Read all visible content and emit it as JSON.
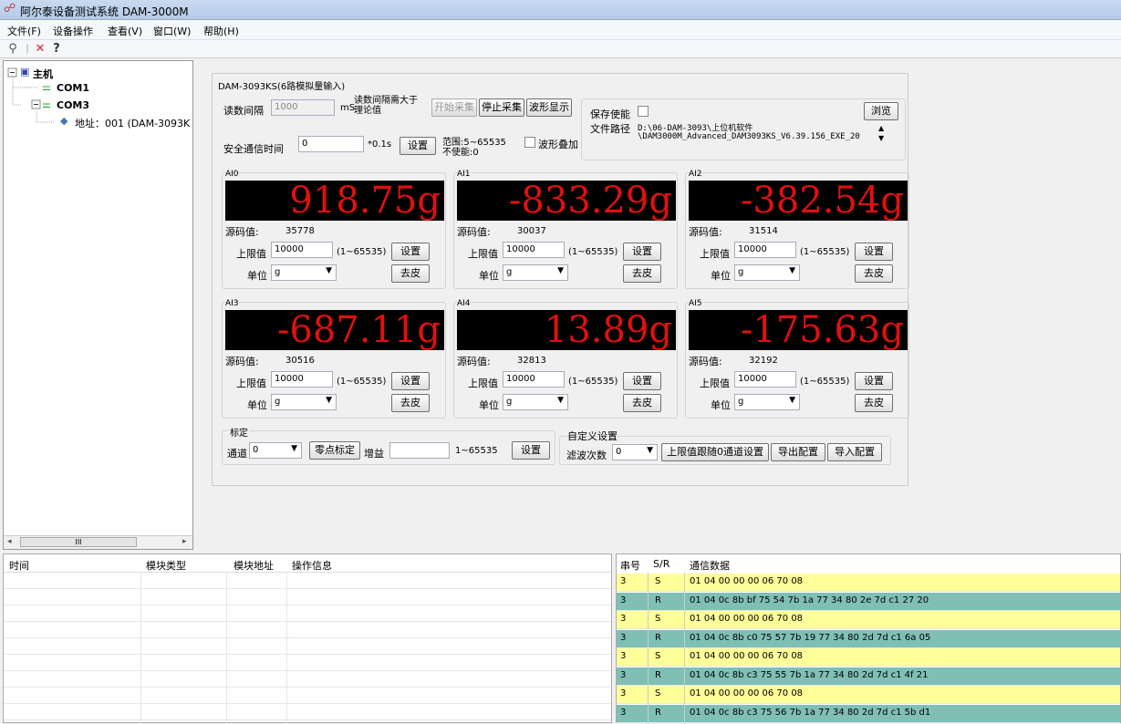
{
  "window": {
    "title": "阿尔泰设备测试系统 DAM-3000M"
  },
  "menu": [
    "文件(F)",
    "设备操作",
    "查看(V)",
    "窗口(W)",
    "帮助(H)"
  ],
  "tree": {
    "root": "主机",
    "com1": "COM1",
    "com3": "COM3",
    "addr": "地址：001 (DAM-3093K"
  },
  "device": {
    "title": "DAM-3093KS(6路模拟量输入)",
    "read_interval_label": "读数间隔",
    "read_interval_value": "1000",
    "read_interval_unit": "mS",
    "interval_note": "读数间隔需大于理论值",
    "btn_start": "开始采集",
    "btn_stop": "停止采集",
    "btn_wave": "波形显示",
    "save_enable": "保存使能",
    "browse": "浏览",
    "file_path_label": "文件路径",
    "file_path_line1": "D:\\06-DAM-3093\\上位机软件",
    "file_path_line2": "\\DAM3000M_Advanced_DAM3093KS_V6.39.156_EXE_20",
    "safe_time_label": "安全通信时间",
    "safe_time_value": "0",
    "safe_time_unit": "*0.1s",
    "safe_set": "设置",
    "range_note1": "范围:5~65535",
    "range_note2": "不使能:0",
    "wave_overlay": "波形叠加"
  },
  "channels": [
    {
      "name": "AI0",
      "value": "918.75g",
      "raw_label": "源码值:",
      "raw": "35778",
      "limit_label": "上限值",
      "limit": "10000",
      "range": "(1~65535)",
      "set": "设置",
      "unit_label": "单位",
      "unit": "g",
      "tare": "去皮"
    },
    {
      "name": "AI1",
      "value": "-833.29g",
      "raw_label": "源码值:",
      "raw": "30037",
      "limit_label": "上限值",
      "limit": "10000",
      "range": "(1~65535)",
      "set": "设置",
      "unit_label": "单位",
      "unit": "g",
      "tare": "去皮"
    },
    {
      "name": "AI2",
      "value": "-382.54g",
      "raw_label": "源码值:",
      "raw": "31514",
      "limit_label": "上限值",
      "limit": "10000",
      "range": "(1~65535)",
      "set": "设置",
      "unit_label": "单位",
      "unit": "g",
      "tare": "去皮"
    },
    {
      "name": "AI3",
      "value": "-687.11g",
      "raw_label": "源码值:",
      "raw": "30516",
      "limit_label": "上限值",
      "limit": "10000",
      "range": "(1~65535)",
      "set": "设置",
      "unit_label": "单位",
      "unit": "g",
      "tare": "去皮"
    },
    {
      "name": "AI4",
      "value": "13.89g",
      "raw_label": "源码值:",
      "raw": "32813",
      "limit_label": "上限值",
      "limit": "10000",
      "range": "(1~65535)",
      "set": "设置",
      "unit_label": "单位",
      "unit": "g",
      "tare": "去皮"
    },
    {
      "name": "AI5",
      "value": "-175.63g",
      "raw_label": "源码值:",
      "raw": "32192",
      "limit_label": "上限值",
      "limit": "10000",
      "range": "(1~65535)",
      "set": "设置",
      "unit_label": "单位",
      "unit": "g",
      "tare": "去皮"
    }
  ],
  "calib": {
    "title": "标定",
    "channel_label": "通道",
    "channel": "0",
    "zero": "零点标定",
    "gain_label": "增益",
    "gain": "",
    "range": "1~65535",
    "set": "设置"
  },
  "custom": {
    "title": "自定义设置",
    "filter_label": "滤波次数",
    "filter": "0",
    "follow": "上限值跟随0通道设置",
    "export": "导出配置",
    "import": "导入配置"
  },
  "log": {
    "headers": [
      "时间",
      "模块类型",
      "模块地址",
      "操作信息"
    ]
  },
  "comm": {
    "headers": [
      "串号",
      "S/R",
      "通信数据"
    ],
    "rows": [
      {
        "id": "3",
        "sr": "S",
        "data": "01 04 00 00 00 06 70 08"
      },
      {
        "id": "3",
        "sr": "R",
        "data": "01 04 0c 8b bf 75 54 7b 1a 77 34 80 2e 7d c1 27 20"
      },
      {
        "id": "3",
        "sr": "S",
        "data": "01 04 00 00 00 06 70 08"
      },
      {
        "id": "3",
        "sr": "R",
        "data": "01 04 0c 8b c0 75 57 7b 19 77 34 80 2d 7d c1 6a 05"
      },
      {
        "id": "3",
        "sr": "S",
        "data": "01 04 00 00 00 06 70 08"
      },
      {
        "id": "3",
        "sr": "R",
        "data": "01 04 0c 8b c3 75 55 7b 1a 77 34 80 2d 7d c1 4f 21"
      },
      {
        "id": "3",
        "sr": "S",
        "data": "01 04 00 00 00 06 70 08"
      },
      {
        "id": "3",
        "sr": "R",
        "data": "01 04 0c 8b c3 75 56 7b 1a 77 34 80 2d 7d c1 5b d1"
      }
    ],
    "colors": {
      "S": "#ffff99",
      "R": "#7fbfb5"
    }
  },
  "scroll": {
    "thumb": "III"
  }
}
